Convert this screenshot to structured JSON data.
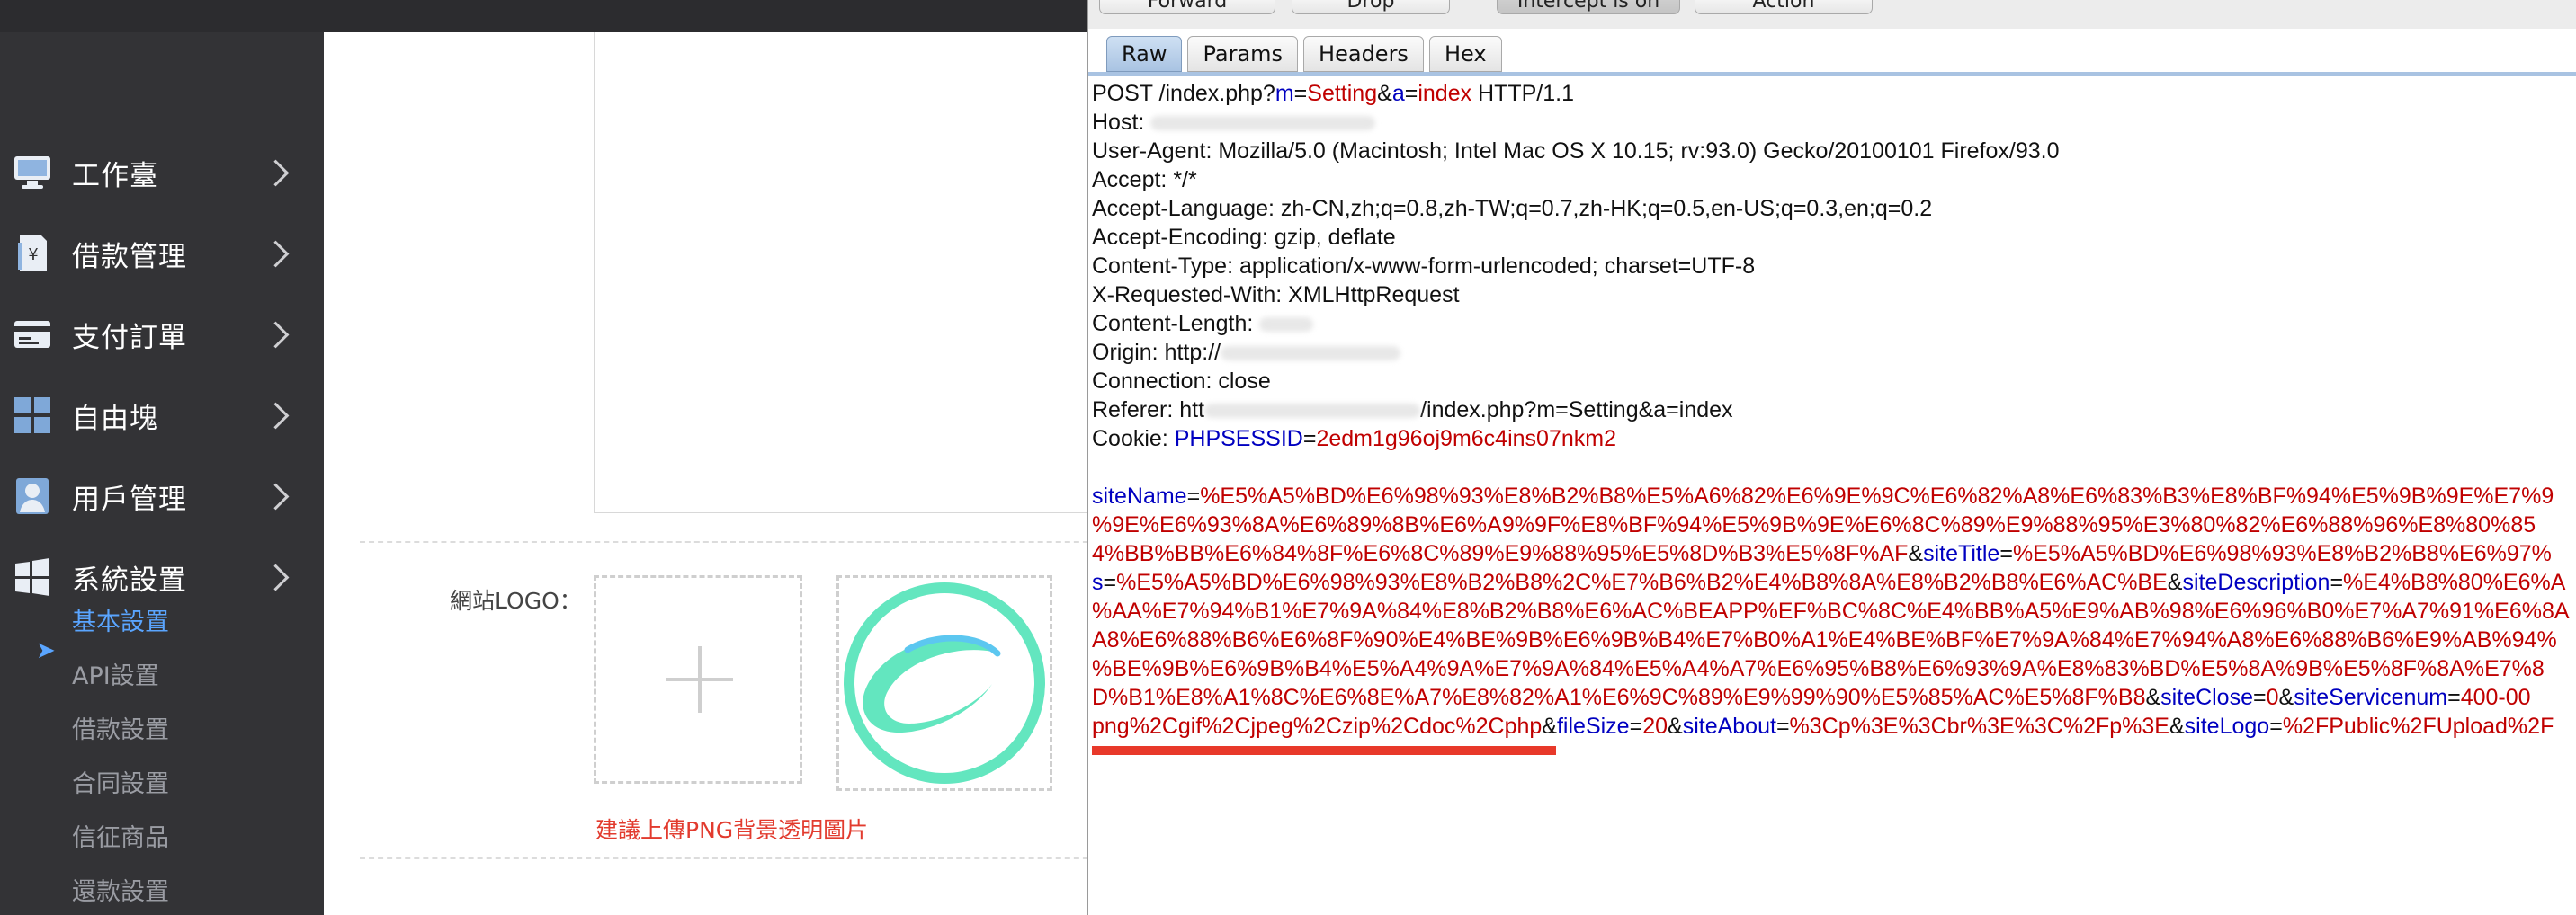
{
  "sidebar": {
    "items": [
      {
        "label": "工作臺",
        "icon": "monitor-icon"
      },
      {
        "label": "借款管理",
        "icon": "yen-document-icon"
      },
      {
        "label": "支付訂單",
        "icon": "card-icon"
      },
      {
        "label": "自由塊",
        "icon": "grid-icon"
      },
      {
        "label": "用戶管理",
        "icon": "user-icon"
      },
      {
        "label": "系統設置",
        "icon": "windows-icon"
      }
    ],
    "subitems": [
      {
        "label": "基本設置",
        "active": true
      },
      {
        "label": "API設置"
      },
      {
        "label": "借款設置"
      },
      {
        "label": "合同設置"
      },
      {
        "label": "信征商品"
      },
      {
        "label": "還款設置"
      }
    ]
  },
  "content": {
    "logo_label": "網站LOGO：",
    "upload_hint": "建議上傳PNG背景透明圖片"
  },
  "colors": {
    "sidebar_bg": "#333336",
    "accent_blue": "#5aa5ff",
    "hint_red": "#e23b2e",
    "logo_teal": "#63e6bf",
    "param_key": "#0000c0",
    "param_value": "#c00000",
    "highlight_bar": "#e8392a"
  },
  "burp": {
    "toolbar": {
      "forward": "Forward",
      "drop": "Drop",
      "intercept": "Intercept is on",
      "action": "Action"
    },
    "tabs": [
      "Raw",
      "Params",
      "Headers",
      "Hex"
    ],
    "request": {
      "line_prefix": "POST /index.php?",
      "line_k1": "m",
      "line_v1": "Setting",
      "line_k2": "a",
      "line_v2": "index",
      "line_suffix": " HTTP/1.1",
      "host": "Host: ",
      "user_agent": "User-Agent: Mozilla/5.0 (Macintosh; Intel Mac OS X 10.15; rv:93.0) Gecko/20100101 Firefox/93.0",
      "accept": "Accept: */*",
      "accept_language": "Accept-Language: zh-CN,zh;q=0.8,zh-TW;q=0.7,zh-HK;q=0.5,en-US;q=0.3,en;q=0.2",
      "accept_encoding": "Accept-Encoding: gzip, deflate",
      "content_type": "Content-Type: application/x-www-form-urlencoded; charset=UTF-8",
      "x_requested_with": "X-Requested-With: XMLHttpRequest",
      "content_length": "Content-Length: ",
      "origin": "Origin: http://",
      "connection": "Connection: close",
      "referer_prefix": "Referer: htt",
      "referer_suffix": "/index.php?m=Setting&a=index",
      "cookie_prefix": "Cookie: ",
      "cookie_key": "PHPSESSID",
      "cookie_value": "2edm1g96oj9m6c4ins07nkm2",
      "body": [
        [
          {
            "k": "siteName",
            "v": "%E5%A5%BD%E6%98%93%E8%B2%B8%E5%A6%82%E6%9E%9C%E6%82%A8%E6%83%B3%E8%BF%94%E5%9B%9E%E7%9"
          }
        ],
        [
          {
            "t": "%9E%E6%93%8A%E6%89%8B%E6%A9%9F%E8%BF%94%E5%9B%9E%E6%8C%89%E9%88%95%E3%80%82%E6%88%96%E8%80%85"
          }
        ],
        [
          {
            "t": "4%BB%BB%E6%84%8F%E6%8C%89%E9%88%95%E5%8D%B3%E5%8F%AF"
          },
          {
            "s": "&"
          },
          {
            "k": "siteTitle",
            "v": "%E5%A5%BD%E6%98%93%E8%B2%B8%E6%97%"
          }
        ],
        [
          {
            "k": "s",
            "v": "%E5%A5%BD%E6%98%93%E8%B2%B8%2C%E7%B6%B2%E4%B8%8A%E8%B2%B8%E6%AC%BE"
          },
          {
            "s": "&"
          },
          {
            "k": "siteDescription",
            "v": "%E4%B8%80%E6%A"
          }
        ],
        [
          {
            "t": "%AA%E7%94%B1%E7%9A%84%E8%B2%B8%E6%AC%BEAPP%EF%BC%8C%E4%BB%A5%E9%AB%98%E6%96%B0%E7%A7%91%E6%8A"
          }
        ],
        [
          {
            "t": "A8%E6%88%B6%E6%8F%90%E4%BE%9B%E6%9B%B4%E7%B0%A1%E4%BE%BF%E7%9A%84%E7%94%A8%E6%88%B6%E9%AB%94%"
          }
        ],
        [
          {
            "t": "%BE%9B%E6%9B%B4%E5%A4%9A%E7%9A%84%E5%A4%A7%E6%95%B8%E6%93%9A%E8%83%BD%E5%8A%9B%E5%8F%8A%E7%8"
          }
        ],
        [
          {
            "t": "D%B1%E8%A1%8C%E6%8E%A7%E8%82%A1%E6%9C%89%E9%99%90%E5%85%AC%E5%8F%B8"
          },
          {
            "s": "&"
          },
          {
            "k": "siteClose",
            "v": "0"
          },
          {
            "s": "&"
          },
          {
            "k": "siteServicenum",
            "v": "400-00"
          }
        ],
        [
          {
            "t": "png%2Cgif%2Cjpeg%2Czip%2Cdoc%2Cphp"
          },
          {
            "s": "&"
          },
          {
            "k": "fileSize",
            "v": "20"
          },
          {
            "s": "&"
          },
          {
            "k": "siteAbout",
            "v": "%3Cp%3E%3Cbr%3E%3C%2Fp%3E"
          },
          {
            "s": "&"
          },
          {
            "k": "siteLogo",
            "v": "%2FPublic%2FUpload%2F"
          }
        ]
      ]
    }
  }
}
